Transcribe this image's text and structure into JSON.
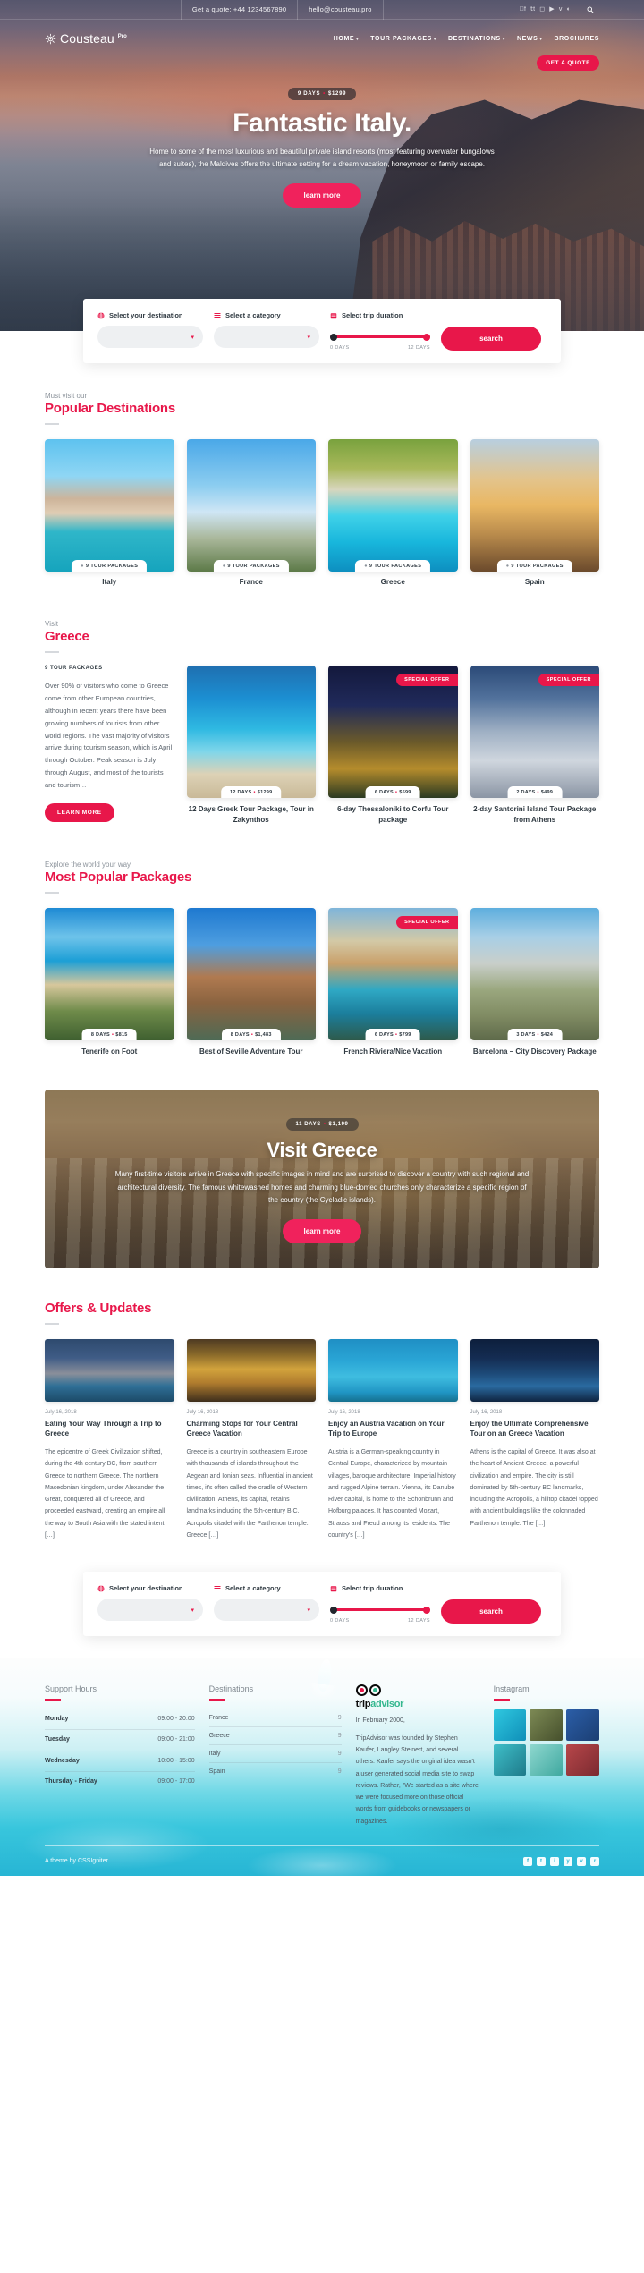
{
  "topbar": {
    "quote": "Get a quote: +44 1234567890",
    "email": "hello@cousteau.pro",
    "social": [
      "facebook",
      "twitter",
      "instagram",
      "youtube",
      "vimeo",
      "rss"
    ],
    "search_icon": "search-icon"
  },
  "brand": {
    "name": "Cousteau",
    "sup": "Pro"
  },
  "nav": {
    "items": [
      {
        "label": "HOME",
        "caret": "▾"
      },
      {
        "label": "TOUR PACKAGES",
        "caret": "▾"
      },
      {
        "label": "DESTINATIONS",
        "caret": "▾"
      },
      {
        "label": "NEWS",
        "caret": "▾"
      },
      {
        "label": "BROCHURES",
        "caret": ""
      }
    ],
    "cta": "GET A QUOTE"
  },
  "hero": {
    "badge_days": "9 DAYS",
    "badge_price": "$1299",
    "title": "Fantastic Italy.",
    "subtitle": "Home to some of the most luxurious and beautiful private island resorts (most featuring overwater bungalows and suites), the Maldives offers the ultimate setting for a dream vacation, honeymoon or family escape.",
    "button": "learn more"
  },
  "search": {
    "destination_label": "Select your destination",
    "category_label": "Select a category",
    "duration_label": "Select trip duration",
    "destination_value": "",
    "category_value": "",
    "duration_min": "0 DAYS",
    "duration_max": "12 DAYS",
    "button": "search",
    "icons": {
      "destination": "globe-icon",
      "category": "list-icon",
      "duration": "calendar-icon"
    }
  },
  "popular_destinations": {
    "kicker": "Must visit our",
    "title": "Popular Destinations",
    "cards": [
      {
        "name": "Italy",
        "packages": "9 TOUR PACKAGES",
        "photo": "ph-italy"
      },
      {
        "name": "France",
        "packages": "9 TOUR PACKAGES",
        "photo": "ph-france"
      },
      {
        "name": "Greece",
        "packages": "9 TOUR PACKAGES",
        "photo": "ph-greece"
      },
      {
        "name": "Spain",
        "packages": "9 TOUR PACKAGES",
        "photo": "ph-spain"
      }
    ]
  },
  "greece": {
    "kicker": "Visit",
    "title": "Greece",
    "packages_count": "9 TOUR PACKAGES",
    "body": "Over 90% of visitors who come to Greece come from other European countries, although in recent years there have been growing numbers of tourists from other world regions. The vast majority of visitors arrive during tourism season, which is April through October. Peak season is July through August, and most of the tourists and tourism…",
    "button": "LEARN MORE",
    "cards": [
      {
        "days": "12 DAYS",
        "price": "$1299",
        "name": "12 Days Greek Tour Package, Tour in Zakynthos",
        "offer": "",
        "photo": "ph-zante"
      },
      {
        "days": "6 DAYS",
        "price": "$599",
        "name": "6-day Thessaloniki to Corfu Tour package",
        "offer": "SPECIAL OFFER",
        "photo": "ph-thess"
      },
      {
        "days": "2 DAYS",
        "price": "$499",
        "name": "2-day Santorini Island Tour Package from Athens",
        "offer": "SPECIAL OFFER",
        "photo": "ph-santo"
      }
    ]
  },
  "packages": {
    "kicker": "Explore the world your way",
    "title": "Most Popular Packages",
    "cards": [
      {
        "days": "8 DAYS",
        "price": "$815",
        "name": "Tenerife on Foot",
        "offer": "",
        "photo": "ph-tenerife"
      },
      {
        "days": "8 DAYS",
        "price": "$1,483",
        "name": "Best of Seville Adventure Tour",
        "offer": "",
        "photo": "ph-seville"
      },
      {
        "days": "6 DAYS",
        "price": "$799",
        "name": "French Riviera/Nice Vacation",
        "offer": "SPECIAL OFFER",
        "photo": "ph-riviera"
      },
      {
        "days": "3 DAYS",
        "price": "$424",
        "name": "Barcelona – City Discovery Package",
        "offer": "",
        "photo": "ph-barca"
      }
    ]
  },
  "banner": {
    "days": "11 DAYS",
    "price": "$1,199",
    "title": "Visit Greece",
    "body": "Many first-time visitors arrive in Greece with specific images in mind and are surprised to discover a country with such regional and architectural diversity. The famous whitewashed homes and charming blue-domed churches only characterize a specific region of the country (the Cycladic islands).",
    "button": "learn more"
  },
  "offers": {
    "title": "Offers & Updates",
    "posts": [
      {
        "date": "July 16, 2018",
        "title": "Eating Your Way Through a Trip to Greece",
        "body": "The epicentre of Greek Civilization shifted, during the 4th century BC, from southern Greece to northern Greece. The northern Macedonian kingdom, under Alexander the Great, conquered all of Greece, and proceeded eastward, creating an empire all the way to South Asia with the stated intent […]",
        "photo": "ph-blog1"
      },
      {
        "date": "July 16, 2018",
        "title": "Charming Stops for Your Central Greece Vacation",
        "body": "Greece is a country in southeastern Europe with thousands of islands throughout the Aegean and Ionian seas. Influential in ancient times, it's often called the cradle of Western civilization. Athens, its capital, retains landmarks including the 5th-century B.C. Acropolis citadel with the Parthenon temple. Greece […]",
        "photo": "ph-blog2"
      },
      {
        "date": "July 16, 2018",
        "title": "Enjoy an Austria Vacation on Your Trip to Europe",
        "body": "Austria is a German-speaking country in Central Europe, characterized by mountain villages, baroque architecture, Imperial history and rugged Alpine terrain. Vienna, its Danube River capital, is home to the Schönbrunn and Hofburg palaces. It has counted Mozart, Strauss and Freud among its residents. The country's […]",
        "photo": "ph-blog3"
      },
      {
        "date": "July 16, 2018",
        "title": "Enjoy the Ultimate Comprehensive Tour on an Greece Vacation",
        "body": "Athens is the capital of Greece. It was also at the heart of Ancient Greece, a powerful civilization and empire. The city is still dominated by 5th-century BC landmarks, including the Acropolis, a hilltop citadel topped with ancient buildings like the colonnaded Parthenon temple. The […]",
        "photo": "ph-blog4"
      }
    ]
  },
  "footer": {
    "support": {
      "title": "Support Hours",
      "rows": [
        {
          "day": "Monday",
          "time": "09:00 - 20:00"
        },
        {
          "day": "Tuesday",
          "time": "09:00 - 21:00"
        },
        {
          "day": "Wednesday",
          "time": "10:00 - 15:00"
        },
        {
          "day": "Thursday - Friday",
          "time": "09:00 - 17:00"
        }
      ]
    },
    "destinations": {
      "title": "Destinations",
      "rows": [
        {
          "name": "France",
          "count": "9"
        },
        {
          "name": "Greece",
          "count": "9"
        },
        {
          "name": "Italy",
          "count": "9"
        },
        {
          "name": "Spain",
          "count": "9"
        }
      ]
    },
    "tripadvisor": {
      "title": "In February 2000,",
      "logo_a": "trip",
      "logo_b": "advisor",
      "body": "TripAdvisor was founded by Stephen Kaufer, Langley Steinert, and several others. Kaufer says the original idea wasn't a user generated social media site to swap reviews. Rather, \"We started as a site where we were focused more on those official words from guidebooks or newspapers or magazines."
    },
    "instagram": {
      "title": "Instagram",
      "cells": [
        "ig1",
        "ig2",
        "ig3",
        "ig4",
        "ig5",
        "ig6"
      ]
    },
    "credit": "A theme by CSSIgniter",
    "social": [
      "f",
      "t",
      "i",
      "y",
      "v",
      "r"
    ]
  },
  "colors": {
    "accent": "#e8174a",
    "accent_light": "#f0225c",
    "footer_aqua": "#27b5d4",
    "text": "#2f3941"
  }
}
